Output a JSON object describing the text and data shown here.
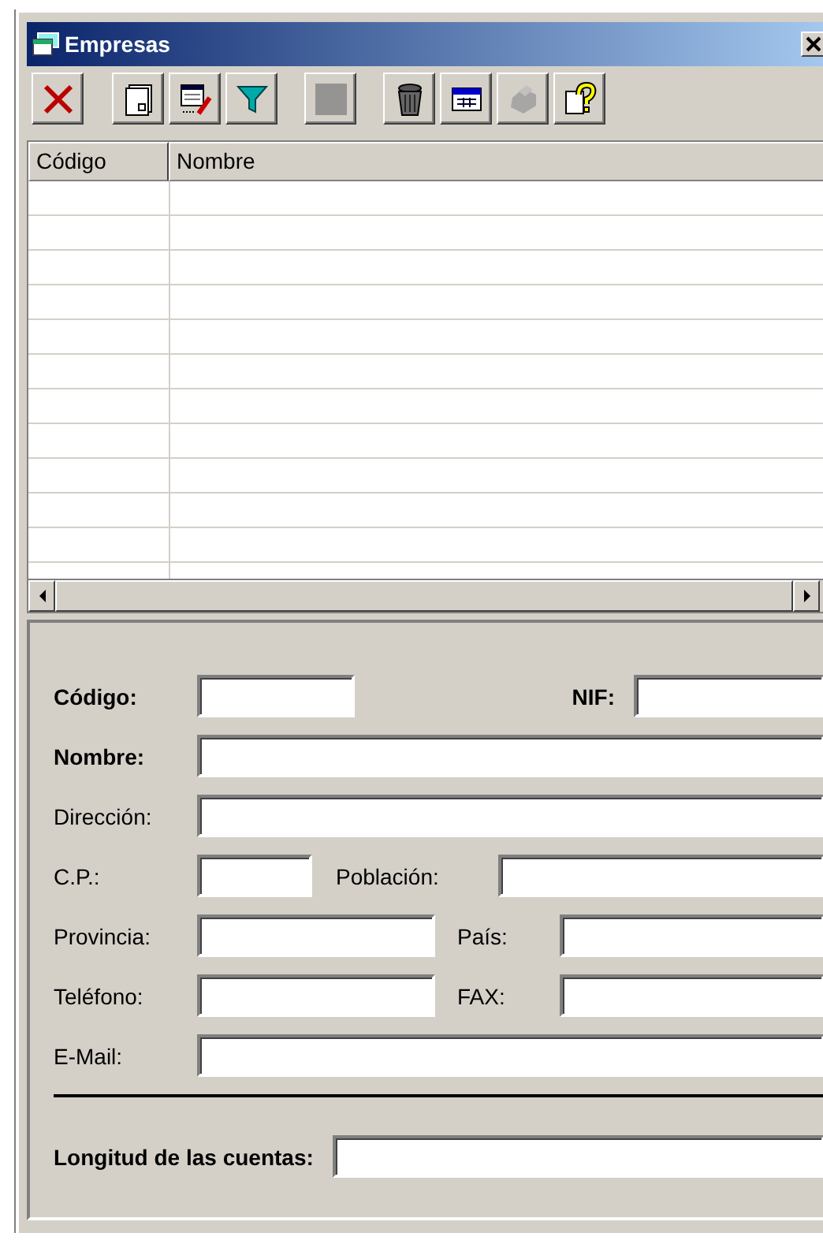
{
  "window": {
    "title": "Empresas"
  },
  "toolbar": [
    [
      {
        "kind": "delete",
        "disabled": false
      }
    ],
    [
      {
        "kind": "new",
        "disabled": false
      },
      {
        "kind": "edit",
        "disabled": false
      },
      {
        "kind": "filter",
        "disabled": false
      }
    ],
    [
      {
        "kind": "blank",
        "disabled": true
      }
    ],
    [
      {
        "kind": "trash",
        "disabled": false
      },
      {
        "kind": "table",
        "disabled": false
      },
      {
        "kind": "printer",
        "disabled": true
      },
      {
        "kind": "help",
        "disabled": false
      }
    ]
  ],
  "table": {
    "columns": [
      "Código",
      "Nombre"
    ]
  },
  "form": {
    "rows": [
      [
        {
          "label": "Código:",
          "bold": true
        },
        {
          "label": "NIF:",
          "bold": true
        }
      ],
      [
        {
          "label": "Nombre:",
          "bold": true
        }
      ],
      [
        {
          "label": "Dirección:",
          "bold": false
        }
      ],
      [
        {
          "label": "C.P.:",
          "bold": false
        },
        {
          "label": "Población:",
          "bold": false
        }
      ],
      [
        {
          "label": "Provincia:",
          "bold": false
        },
        {
          "label": "País:",
          "bold": false
        }
      ],
      [
        {
          "label": "Teléfono:",
          "bold": false
        },
        {
          "label": "FAX:",
          "bold": false
        }
      ],
      [
        {
          "label": "E-Mail:",
          "bold": false
        }
      ]
    ],
    "footer": {
      "label": "Longitud de las cuentas:",
      "bold": true
    }
  }
}
